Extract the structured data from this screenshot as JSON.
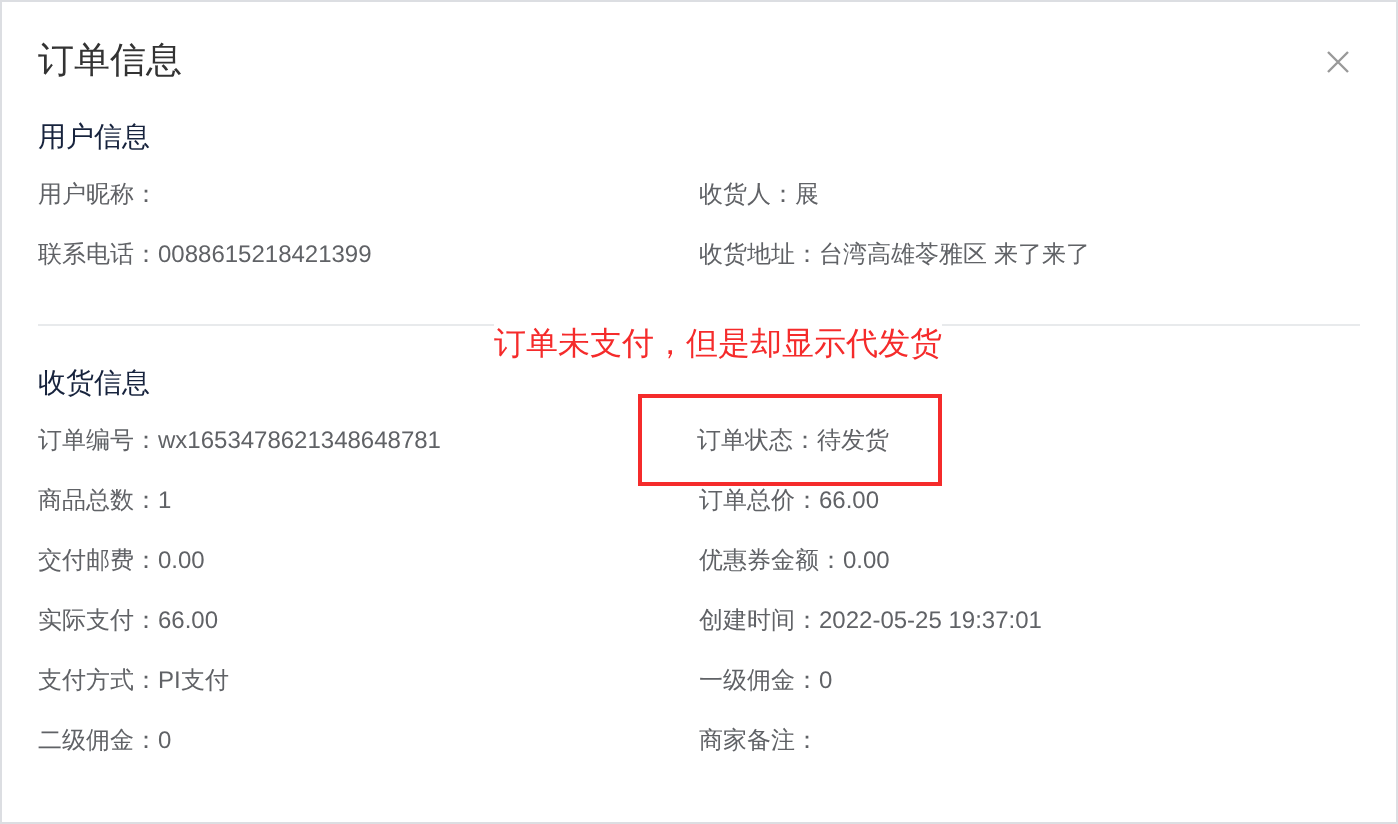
{
  "dialog": {
    "title": "订单信息"
  },
  "sections": [
    {
      "title": "用户信息",
      "items": [
        {
          "text": "用户昵称：",
          "highlighted": false
        },
        {
          "text": "收货人：展",
          "highlighted": false
        },
        {
          "text": "联系电话：0088615218421399",
          "highlighted": false
        },
        {
          "text": "收货地址：台湾高雄苓雅区 来了来了",
          "highlighted": false
        }
      ]
    },
    {
      "title": "收货信息",
      "items": [
        {
          "text": "订单编号：wx1653478621348648781",
          "highlighted": false
        },
        {
          "text": "订单状态：待发货",
          "highlighted": true
        },
        {
          "text": "商品总数：1",
          "highlighted": false
        },
        {
          "text": "订单总价：66.00",
          "highlighted": false
        },
        {
          "text": "交付邮费：0.00",
          "highlighted": false
        },
        {
          "text": "优惠券金额：0.00",
          "highlighted": false
        },
        {
          "text": "实际支付：66.00",
          "highlighted": false
        },
        {
          "text": "创建时间：2022-05-25 19:37:01",
          "highlighted": false
        },
        {
          "text": "支付方式：PI支付",
          "highlighted": false
        },
        {
          "text": "一级佣金：0",
          "highlighted": false
        },
        {
          "text": "二级佣金：0",
          "highlighted": false
        },
        {
          "text": "商家备注：",
          "highlighted": false
        }
      ]
    }
  ],
  "annotation": "订单未支付，但是却显示代发货"
}
